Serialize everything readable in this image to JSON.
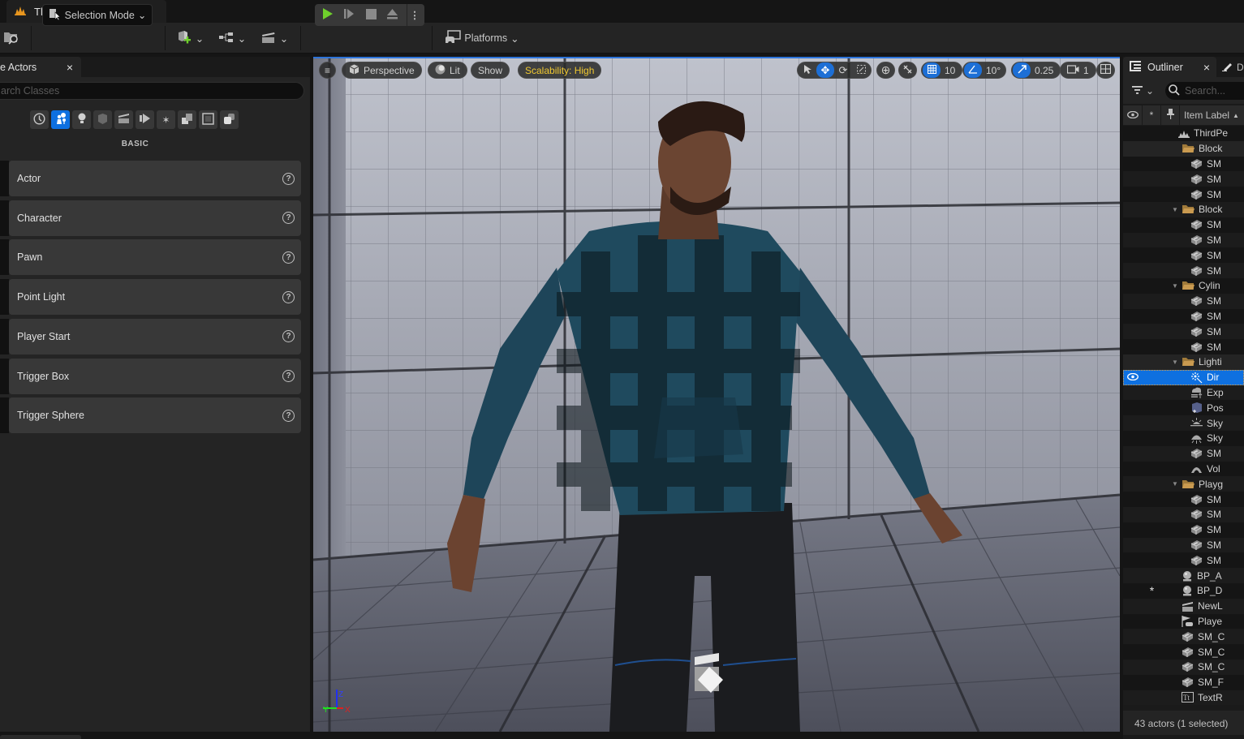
{
  "window": {
    "document_tab": "ThirdPersonMap",
    "logo": "unreal-map-icon"
  },
  "toolbar": {
    "selection_mode": "Selection Mode",
    "platforms": "Platforms",
    "icons": [
      "content-browser-icon",
      "add-actor-icon",
      "blueprint-icon",
      "cinematics-icon"
    ],
    "play_controls": [
      "play-icon",
      "frame-skip-icon",
      "stop-icon",
      "eject-icon",
      "more-options-icon"
    ]
  },
  "place_actors": {
    "tab_label": "e Actors",
    "close": "×",
    "search_placeholder": "arch Classes",
    "categories": [
      "recent-icon",
      "basic-icon",
      "lights-icon",
      "shapes-icon",
      "cinematic-icon",
      "visual-effects-icon",
      "volumes-icon",
      "all-classes-icon",
      "geometry-icon",
      "stacked-icon"
    ],
    "active_category_index": 1,
    "section_label": "BASIC",
    "items": [
      {
        "label": "Actor"
      },
      {
        "label": "Character"
      },
      {
        "label": "Pawn"
      },
      {
        "label": "Point Light"
      },
      {
        "label": "Player Start"
      },
      {
        "label": "Trigger Box"
      },
      {
        "label": "Trigger Sphere"
      }
    ]
  },
  "viewport": {
    "menu": "≡",
    "view_mode": "Perspective",
    "lighting": "Lit",
    "show": "Show",
    "scalability": "Scalability: High",
    "scalability_color": "#f0c830",
    "grid_snap": "10",
    "rotation_snap": "10°",
    "scale_snap": "0.25",
    "camera_speed": "1",
    "active_color": "#1d6fd6",
    "axis": {
      "x": "X",
      "y": "Y",
      "z": "Z"
    }
  },
  "outliner": {
    "tab_label": "Outliner",
    "close": "×",
    "second_tab": "D",
    "search_placeholder": "Search...",
    "header_label": "Item Label",
    "rows": [
      {
        "label": "ThirdPe",
        "icon": "level-icon",
        "indent": 0,
        "type": "level"
      },
      {
        "label": "Block",
        "icon": "folder-icon",
        "indent": 1,
        "type": "folder",
        "expanded": false
      },
      {
        "label": "SM",
        "icon": "static-mesh-icon",
        "indent": 2
      },
      {
        "label": "SM",
        "icon": "static-mesh-icon",
        "indent": 2
      },
      {
        "label": "SM",
        "icon": "static-mesh-icon",
        "indent": 2
      },
      {
        "label": "Block",
        "icon": "folder-icon",
        "indent": 1,
        "type": "folder",
        "expanded": true
      },
      {
        "label": "SM",
        "icon": "static-mesh-icon",
        "indent": 2
      },
      {
        "label": "SM",
        "icon": "static-mesh-icon",
        "indent": 2
      },
      {
        "label": "SM",
        "icon": "static-mesh-icon",
        "indent": 2
      },
      {
        "label": "SM",
        "icon": "static-mesh-icon",
        "indent": 2
      },
      {
        "label": "Cylin",
        "icon": "folder-icon",
        "indent": 1,
        "type": "folder",
        "expanded": true
      },
      {
        "label": "SM",
        "icon": "static-mesh-icon",
        "indent": 2
      },
      {
        "label": "SM",
        "icon": "static-mesh-icon",
        "indent": 2
      },
      {
        "label": "SM",
        "icon": "static-mesh-icon",
        "indent": 2
      },
      {
        "label": "SM",
        "icon": "static-mesh-icon",
        "indent": 2
      },
      {
        "label": "Lighti",
        "icon": "folder-icon",
        "indent": 1,
        "type": "folder",
        "expanded": true
      },
      {
        "label": "Dir",
        "icon": "directional-light-icon",
        "indent": 2,
        "selected": true
      },
      {
        "label": "Exp",
        "icon": "exponential-fog-icon",
        "indent": 2
      },
      {
        "label": "Pos",
        "icon": "post-process-icon",
        "indent": 2
      },
      {
        "label": "Sky",
        "icon": "sky-atmosphere-icon",
        "indent": 2
      },
      {
        "label": "Sky",
        "icon": "sky-light-icon",
        "indent": 2
      },
      {
        "label": "SM",
        "icon": "static-mesh-icon",
        "indent": 2
      },
      {
        "label": "Vol",
        "icon": "volumetric-cloud-icon",
        "indent": 2
      },
      {
        "label": "Playg",
        "icon": "folder-icon",
        "indent": 1,
        "type": "folder",
        "expanded": true
      },
      {
        "label": "SM",
        "icon": "static-mesh-icon",
        "indent": 2
      },
      {
        "label": "SM",
        "icon": "static-mesh-icon",
        "indent": 2
      },
      {
        "label": "SM",
        "icon": "static-mesh-icon",
        "indent": 2
      },
      {
        "label": "SM",
        "icon": "static-mesh-icon",
        "indent": 2
      },
      {
        "label": "SM",
        "icon": "static-mesh-icon",
        "indent": 2
      },
      {
        "label": "BP_A",
        "icon": "blueprint-actor-icon",
        "indent": 1
      },
      {
        "label": "BP_D",
        "icon": "blueprint-actor-icon",
        "indent": 1,
        "starred": true
      },
      {
        "label": "NewL",
        "icon": "level-sequence-icon",
        "indent": 1
      },
      {
        "label": "Playe",
        "icon": "player-start-icon",
        "indent": 1
      },
      {
        "label": "SM_C",
        "icon": "static-mesh-icon",
        "indent": 1
      },
      {
        "label": "SM_C",
        "icon": "static-mesh-icon",
        "indent": 1
      },
      {
        "label": "SM_C",
        "icon": "static-mesh-icon",
        "indent": 1
      },
      {
        "label": "SM_F",
        "icon": "static-mesh-icon",
        "indent": 1
      },
      {
        "label": "TextR",
        "icon": "text-render-icon",
        "indent": 1
      }
    ],
    "status": "43 actors (1 selected)"
  }
}
